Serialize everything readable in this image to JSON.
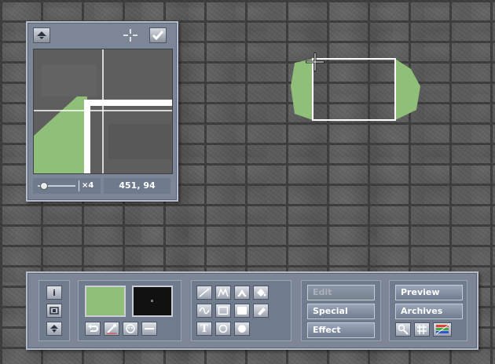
{
  "magnifier": {
    "coordinates": "451, 94",
    "zoom_factor": "×4",
    "zoom_level": 0.1
  },
  "toolbar": {
    "left_buttons": [
      "i"
    ],
    "menu_buttons": {
      "edit": "Edit",
      "special": "Special",
      "effect": "Effect"
    },
    "nav_buttons": {
      "preview": "Preview",
      "archives": "Archives"
    },
    "text_tool": "T"
  },
  "colors": {
    "fill_color": "#8fbf78",
    "line_color": "#111111",
    "shape_outline": "#ffffff",
    "panel": "#7c8696"
  },
  "icons": [
    "scroll-up-icon",
    "crosshair-icon",
    "checkmark-icon",
    "info-icon",
    "screen-icon",
    "undo-icon",
    "eyedropper-icon",
    "mask-icon",
    "line-width-icon",
    "line-tool-icon",
    "polygon-tool-icon",
    "filled-polygon-tool-icon",
    "fill-bucket-icon",
    "curve-tool-icon",
    "rectangle-tool-icon",
    "filled-rectangle-tool-icon",
    "eraser-icon",
    "text-tool-icon",
    "circle-tool-icon",
    "filled-circle-tool-icon",
    "magnifier-icon",
    "grid-icon",
    "color-palette-icon"
  ]
}
